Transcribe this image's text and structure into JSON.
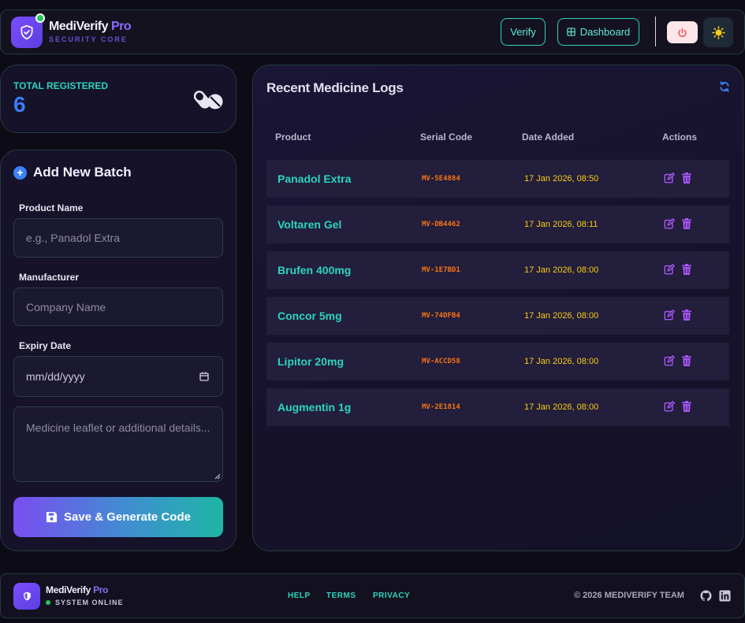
{
  "colors": {
    "accent_teal": "#2dd4bf",
    "accent_purple": "#8b6bff",
    "serial_orange": "#f97316",
    "date_yellow": "#facc15",
    "stat_blue": "#3b7cf6"
  },
  "header": {
    "brand_name": "MediVerify",
    "brand_pro": " Pro",
    "brand_subtitle": "SECURITY CORE",
    "verify_label": "Verify",
    "dashboard_label": "Dashboard",
    "icons": [
      "shield-check-icon",
      "grid-icon",
      "power-icon",
      "sun-icon"
    ]
  },
  "stats": {
    "label": "TOTAL REGISTERED",
    "value": "6",
    "icon": "pills-icon"
  },
  "form": {
    "title": "Add New Batch",
    "product_name_label": "Product Name",
    "product_name_placeholder": "e.g., Panadol Extra",
    "manufacturer_label": "Manufacturer",
    "manufacturer_placeholder": "Company Name",
    "expiry_label": "Expiry Date",
    "expiry_placeholder": "mm/dd/yyyy",
    "notes_placeholder": "Medicine leaflet or additional details...",
    "save_label": "Save & Generate Code"
  },
  "logs": {
    "title": "Recent Medicine Logs",
    "columns": [
      "Product",
      "Serial Code",
      "Date Added",
      "Actions"
    ],
    "rows": [
      {
        "product": "Panadol Extra",
        "serial": "MV-5E4884",
        "date": "17 Jan 2026, 08:50"
      },
      {
        "product": "Voltaren Gel",
        "serial": "MV-DB4462",
        "date": "17 Jan 2026, 08:11"
      },
      {
        "product": "Brufen 400mg",
        "serial": "MV-1E7BD1",
        "date": "17 Jan 2026, 08:00"
      },
      {
        "product": "Concor 5mg",
        "serial": "MV-74DFB4",
        "date": "17 Jan 2026, 08:00"
      },
      {
        "product": "Lipitor 20mg",
        "serial": "MV-ACCD58",
        "date": "17 Jan 2026, 08:00"
      },
      {
        "product": "Augmentin 1g",
        "serial": "MV-2E1814",
        "date": "17 Jan 2026, 08:00"
      }
    ]
  },
  "footer": {
    "brand_name": "MediVerify",
    "brand_pro": " Pro",
    "status": "SYSTEM ONLINE",
    "links": [
      "HELP",
      "TERMS",
      "PRIVACY"
    ],
    "copyright": "© 2026 MEDIVERIFY TEAM"
  }
}
